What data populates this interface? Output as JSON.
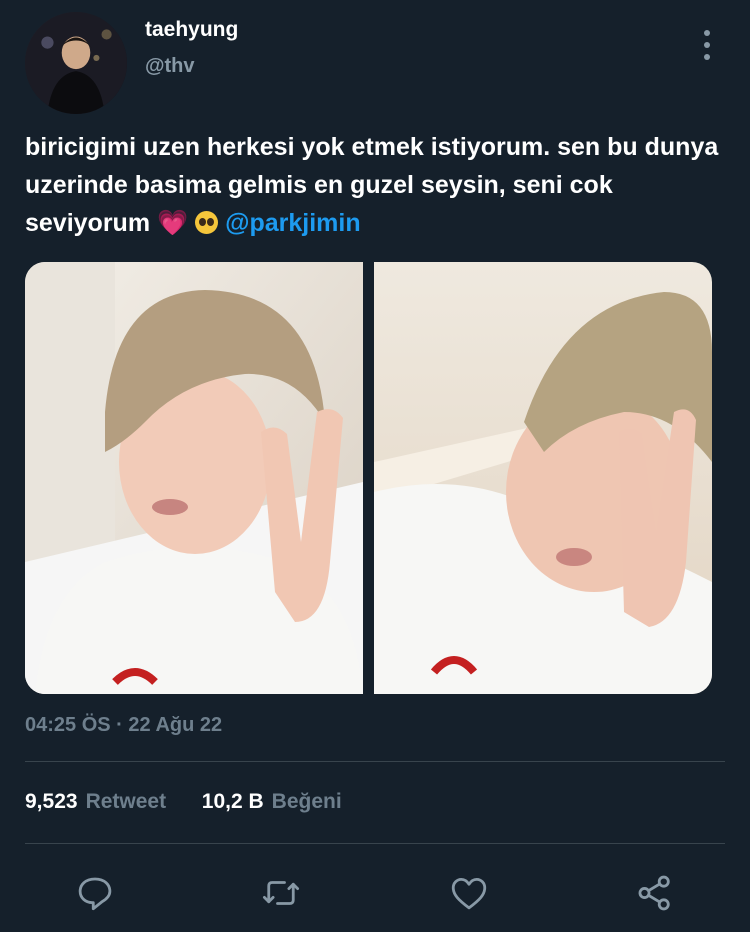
{
  "user": {
    "display_name": "taehyung",
    "handle": "@thv"
  },
  "tweet": {
    "text_parts": [
      "biricigimi uzen herkesi yok etmek istiyorum. sen bu dunya uzerinde basima gelmis en guzel seysin, seni cok seviyorum "
    ],
    "heart_emoji": "💗",
    "mention": "@parkjimin",
    "timestamp": "04:25 ÖS · 22 Ağu 22"
  },
  "stats": {
    "retweets_count": "9,523",
    "retweets_label": "Retweet",
    "likes_count": "10,2 B",
    "likes_label": "Beğeni"
  },
  "icons": {
    "more": "more-vertical-icon",
    "reply": "reply-icon",
    "retweet": "retweet-icon",
    "like": "heart-icon",
    "share": "share-icon"
  },
  "colors": {
    "background": "#15202b",
    "secondary_text": "#8899a6",
    "mention": "#1d9bf0",
    "divider": "#38444d"
  }
}
